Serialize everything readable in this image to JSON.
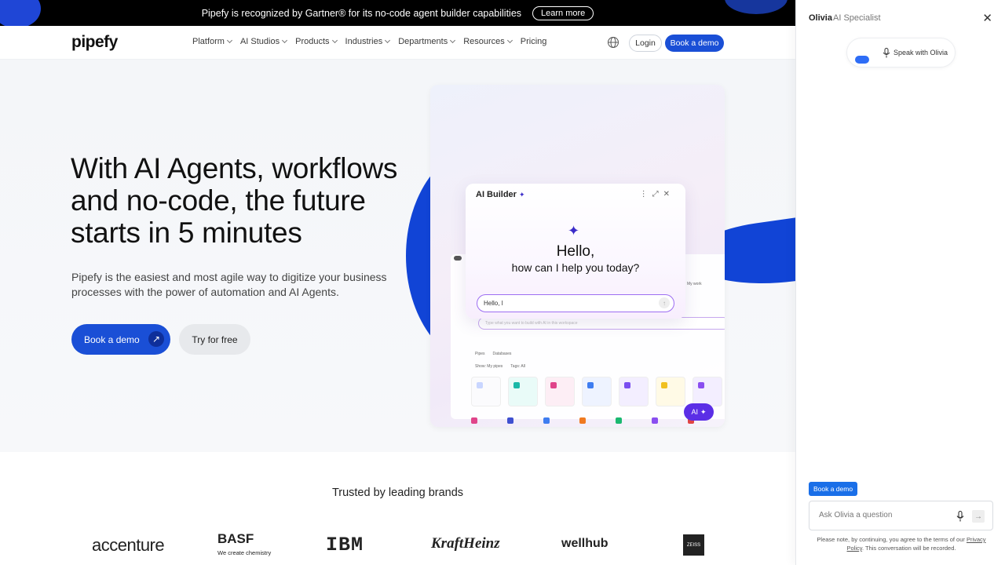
{
  "banner": {
    "text": "Pipefy is recognized by Gartner® for its no-code agent builder capabilities",
    "cta": "Learn more"
  },
  "nav": {
    "logo": "pipefy",
    "items": [
      {
        "label": "Platform",
        "dropdown": true
      },
      {
        "label": "AI Studios",
        "dropdown": true
      },
      {
        "label": "Products",
        "dropdown": true
      },
      {
        "label": "Industries",
        "dropdown": true
      },
      {
        "label": "Departments",
        "dropdown": true
      },
      {
        "label": "Resources",
        "dropdown": true
      },
      {
        "label": "Pricing",
        "dropdown": false
      }
    ],
    "login": "Login",
    "book_demo": "Book a demo"
  },
  "hero": {
    "headline": "With AI Agents, workflows and no-code, the future starts in 5 minutes",
    "subtitle": "Pipefy is the easiest and most agile way to digitize your business processes with the power of automation and AI Agents.",
    "primary_cta": "Book a demo",
    "secondary_cta": "Try for free"
  },
  "mockup": {
    "ai_builder_title": "AI Builder",
    "greeting": "Hello,",
    "prompt": "how can I help you today?",
    "input_value": "Hello, I",
    "bg_input_placeholder": "Type what you want to build with AI in this workspace",
    "tabs": [
      "Pipes",
      "Databases"
    ],
    "filters": [
      "Show: My pipes",
      "Tags: All"
    ],
    "side_label": "My work",
    "tiles": [
      {
        "label": "Create pipe",
        "color": "#c9d6ff"
      },
      {
        "label": "Internal Request",
        "color": "#1bb8a8"
      },
      {
        "label": "Document Review",
        "color": "#e0448a"
      },
      {
        "label": "Information Registration",
        "color": "#3f7df0"
      },
      {
        "label": "Review Creative",
        "color": "#7a4ef0"
      },
      {
        "label": "Report Verification",
        "color": "#f0c020"
      },
      {
        "label": "Content Team Requests",
        "color": "#8a4ef0"
      }
    ],
    "ai_pill": "AI"
  },
  "trusted": {
    "heading": "Trusted by leading brands",
    "brands": [
      "accenture",
      "BASF",
      "We create chemistry",
      "IBM",
      "KraftHeinz",
      "wellhub",
      "ZEISS"
    ]
  },
  "chat": {
    "agent_name": "Olivia",
    "agent_role": "AI Specialist",
    "speak_label": "Speak with Olivia",
    "book_demo_chip": "Book a demo",
    "input_placeholder": "Ask Olivia a question",
    "disclaimer_before": "Please note, by continuing, you agree to the terms of our",
    "privacy_link": "Privacy Policy",
    "disclaimer_after": ". This conversation will be recorded."
  },
  "colors": {
    "brand_blue": "#1a4fd6",
    "hero_blue": "#1144d6",
    "ai_purple": "#5b2ee6"
  }
}
